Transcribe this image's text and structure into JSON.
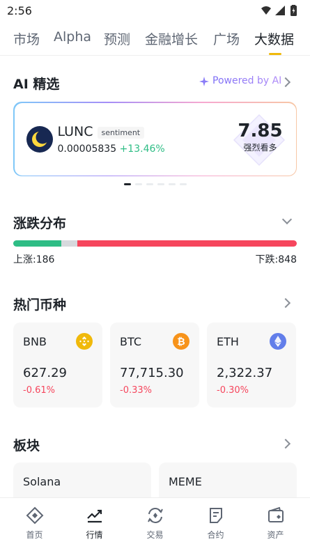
{
  "status_bar": {
    "time": "2:56"
  },
  "top_tabs": [
    {
      "label": "市场",
      "active": false
    },
    {
      "label": "Alpha",
      "active": false
    },
    {
      "label": "预测",
      "active": false
    },
    {
      "label": "金融增长",
      "active": false
    },
    {
      "label": "广场",
      "active": false
    },
    {
      "label": "大数据",
      "active": true
    }
  ],
  "ai_picks": {
    "title": "AI 精选",
    "powered_by": "Powered by AI",
    "card": {
      "symbol": "LUNC",
      "tag": "sentiment",
      "price": "0.00005835",
      "change": "+13.46%",
      "score": "7.85",
      "score_label": "强烈看多"
    },
    "carousel_pages": 6,
    "carousel_active": 0
  },
  "distribution": {
    "title": "涨跌分布",
    "up_label": "上涨:",
    "up_count": "186",
    "down_label": "下跌:",
    "down_count": "848",
    "flat_fraction": 0.055
  },
  "hot_coins": {
    "title": "热门币种",
    "items": [
      {
        "symbol": "BNB",
        "price": "627.29",
        "change": "-0.61%",
        "icon": "bnb-icon",
        "color": "#f0b90b"
      },
      {
        "symbol": "BTC",
        "price": "77,715.30",
        "change": "-0.33%",
        "icon": "btc-icon",
        "color": "#f7931a"
      },
      {
        "symbol": "ETH",
        "price": "2,322.37",
        "change": "-0.30%",
        "icon": "eth-icon",
        "color": "#627eea"
      }
    ]
  },
  "sectors": {
    "title": "板块",
    "items": [
      {
        "name": "Solana"
      },
      {
        "name": "MEME"
      }
    ]
  },
  "bottom_nav": [
    {
      "label": "首页",
      "icon": "home-icon",
      "active": false
    },
    {
      "label": "行情",
      "icon": "markets-icon",
      "active": true
    },
    {
      "label": "交易",
      "icon": "trade-icon",
      "active": false
    },
    {
      "label": "合约",
      "icon": "futures-icon",
      "active": false
    },
    {
      "label": "资产",
      "icon": "wallet-icon",
      "active": false
    }
  ],
  "colors": {
    "accent": "#f0b90b",
    "up": "#2ebd85",
    "down": "#f6465d"
  }
}
